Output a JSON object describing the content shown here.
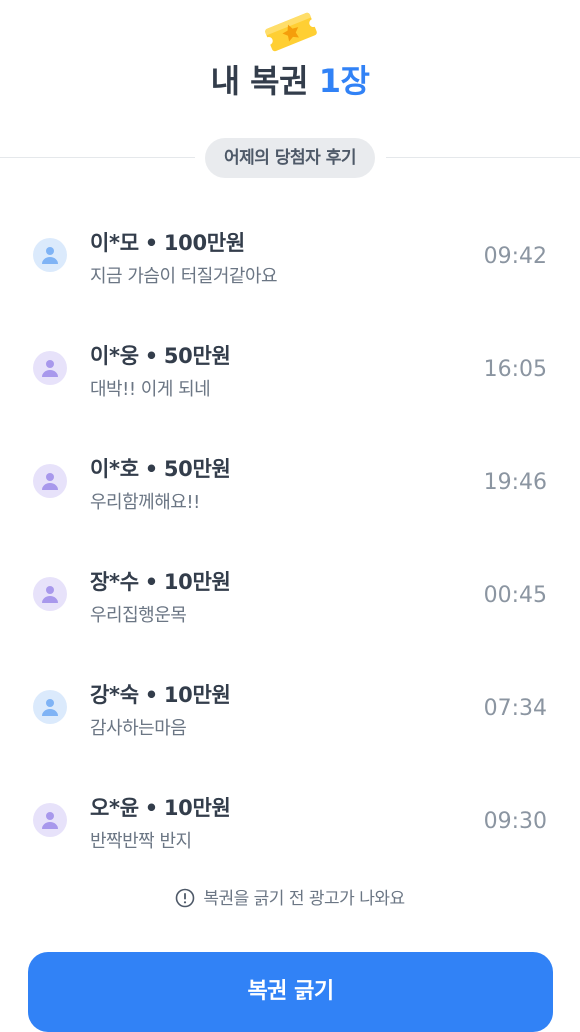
{
  "header": {
    "icon": "ticket-star-icon",
    "title_prefix": "내 복권",
    "title_count": "1장"
  },
  "section": {
    "label": "어제의 당첨자 후기"
  },
  "reviews": [
    {
      "name": "이*모",
      "separator": "•",
      "amount": "100만원",
      "comment": "지금 가슴이 터질거같아요",
      "time": "09:42",
      "avatar_color": "#dbeafc"
    },
    {
      "name": "이*웅",
      "separator": "•",
      "amount": "50만원",
      "comment": "대박!! 이게 되네",
      "time": "16:05",
      "avatar_color": "#e7e2fa"
    },
    {
      "name": "이*호",
      "separator": "•",
      "amount": "50만원",
      "comment": "우리함께해요!!",
      "time": "19:46",
      "avatar_color": "#e7e2fa"
    },
    {
      "name": "장*수",
      "separator": "•",
      "amount": "10만원",
      "comment": "우리집행운목",
      "time": "00:45",
      "avatar_color": "#e7e2fa"
    },
    {
      "name": "강*숙",
      "separator": "•",
      "amount": "10만원",
      "comment": "감사하는마음",
      "time": "07:34",
      "avatar_color": "#dbeafc"
    },
    {
      "name": "오*윤",
      "separator": "•",
      "amount": "10만원",
      "comment": "반짝반짝 반지",
      "time": "09:30",
      "avatar_color": "#e7e2fa"
    }
  ],
  "notice": {
    "icon": "info-circle-icon",
    "text": "복권을 긁기 전 광고가 나와요"
  },
  "cta": {
    "label": "복권 긁기",
    "color": "#3182f6"
  },
  "colors": {
    "accent": "#3182f6",
    "ticket_yellow": "#ffcf33",
    "star_orange": "#f59e0b"
  }
}
